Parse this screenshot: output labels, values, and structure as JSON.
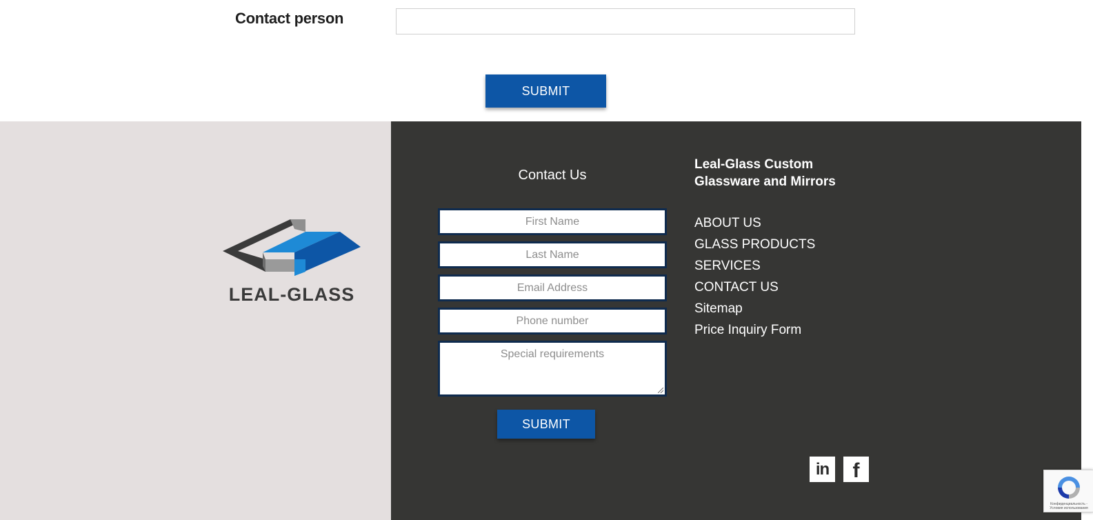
{
  "form": {
    "contact_label": "Contact person",
    "contact_value": "",
    "submit_label": "SUBMIT"
  },
  "footer": {
    "logo_text": "LEAL-GLASS",
    "contact_title": "Contact Us",
    "fields": {
      "first_name": "First Name",
      "last_name": "Last Name",
      "email": "Email Address",
      "phone": "Phone number",
      "requirements": "Special requirements"
    },
    "submit_label": "SUBMIT",
    "brand_title": "Leal-Glass Custom Glassware and Mirrors",
    "nav": [
      "ABOUT US",
      "GLASS PRODUCTS",
      "SERVICES",
      "CONTACT US",
      "Sitemap",
      "Price Inquiry Form"
    ],
    "social": {
      "linkedin_icon": "linkedin-icon",
      "linkedin_text": "in",
      "facebook_icon": "facebook-icon",
      "facebook_text": "f"
    },
    "recaptcha_text": "Конфиденциальность - Условия использования"
  },
  "colors": {
    "accent": "#0d56a6",
    "footer_dark": "#363634",
    "footer_light": "#e4dfdf",
    "field_border": "#0f2b4e"
  }
}
